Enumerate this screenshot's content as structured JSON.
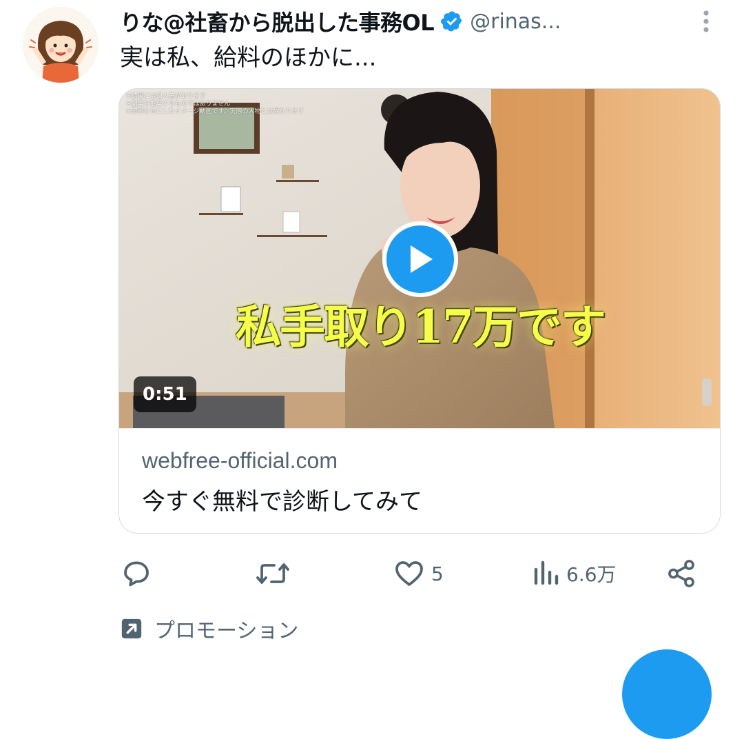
{
  "tweet": {
    "display_name": "りな@社畜から脱出した事務OL",
    "handle": "@rinas...",
    "text": "実は私、給料のほかに...",
    "verified_color": "#1d9bf0"
  },
  "media": {
    "overlay_caption": "私手取り17万です",
    "disclaimer_text": "※結果には個人差があります\n※副業を推奨するものではありません\n※実例を元にしたイメージ動画です。実際の人物とは異なります",
    "duration": "0:51",
    "play_icon": "play-icon"
  },
  "card": {
    "domain": "webfree-official.com",
    "title": "今すぐ無料で診断してみて"
  },
  "actions": {
    "reply_icon": "reply-icon",
    "retweet_icon": "retweet-icon",
    "like_icon": "heart-icon",
    "like_count": "5",
    "views_icon": "views-chart-icon",
    "views_count": "6.6万",
    "share_icon": "share-icon"
  },
  "promotion": {
    "label": "プロモーション",
    "icon": "promoted-arrow-icon"
  },
  "colors": {
    "accent": "#1d9bf0",
    "secondary_text": "#536471",
    "caption_yellow": "#f5ff4a"
  }
}
